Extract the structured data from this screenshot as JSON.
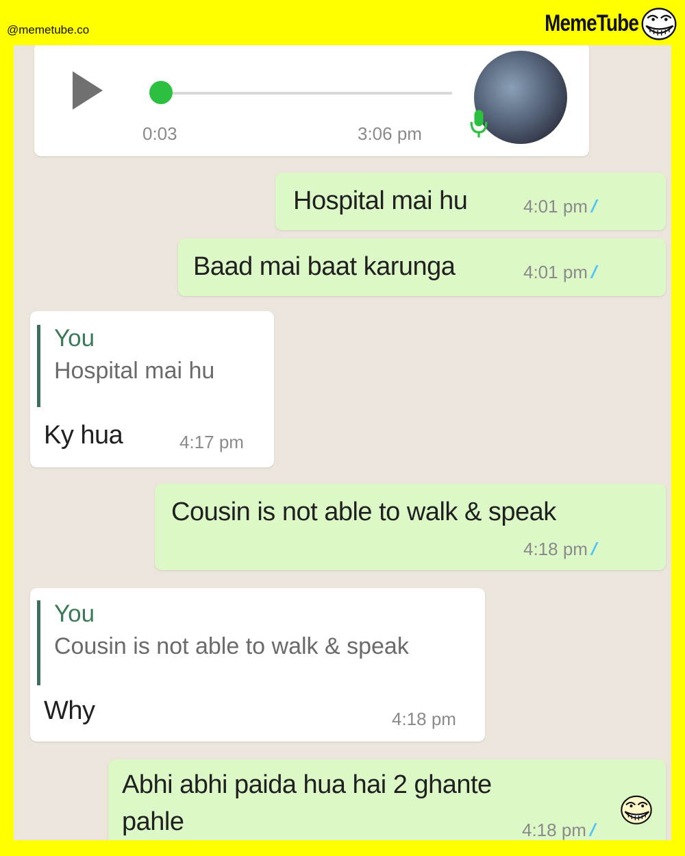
{
  "watermark": {
    "handle": "@memetube.co",
    "brand": "MemeTube"
  },
  "voice_note": {
    "duration": "0:03",
    "time": "3:06 pm"
  },
  "messages": [
    {
      "text": "Hospital mai hu",
      "time": "4:01 pm"
    },
    {
      "text": "Baad mai baat karunga",
      "time": "4:01 pm"
    },
    {
      "quote_name": "You",
      "quote_text": "Hospital mai hu",
      "text": "Ky hua",
      "time": "4:17 pm"
    },
    {
      "text": "Cousin is not able to walk & speak",
      "time": "4:18 pm"
    },
    {
      "quote_name": "You",
      "quote_text": "Cousin is not able to walk & speak",
      "text": "Why",
      "time": "4:18 pm"
    },
    {
      "text_line1": "Abhi abhi paida hua hai 2 ghante",
      "text_line2": "pahle",
      "time": "4:18 pm"
    }
  ],
  "colors": {
    "frame": "#ffff00",
    "chat_bg": "#ece5dc",
    "outgoing": "#dcf8c6",
    "incoming": "#ffffff",
    "read_ticks": "#4fc3f7"
  },
  "icons": [
    "play-icon",
    "microphone-icon",
    "double-check-icon",
    "troll-face-icon"
  ]
}
